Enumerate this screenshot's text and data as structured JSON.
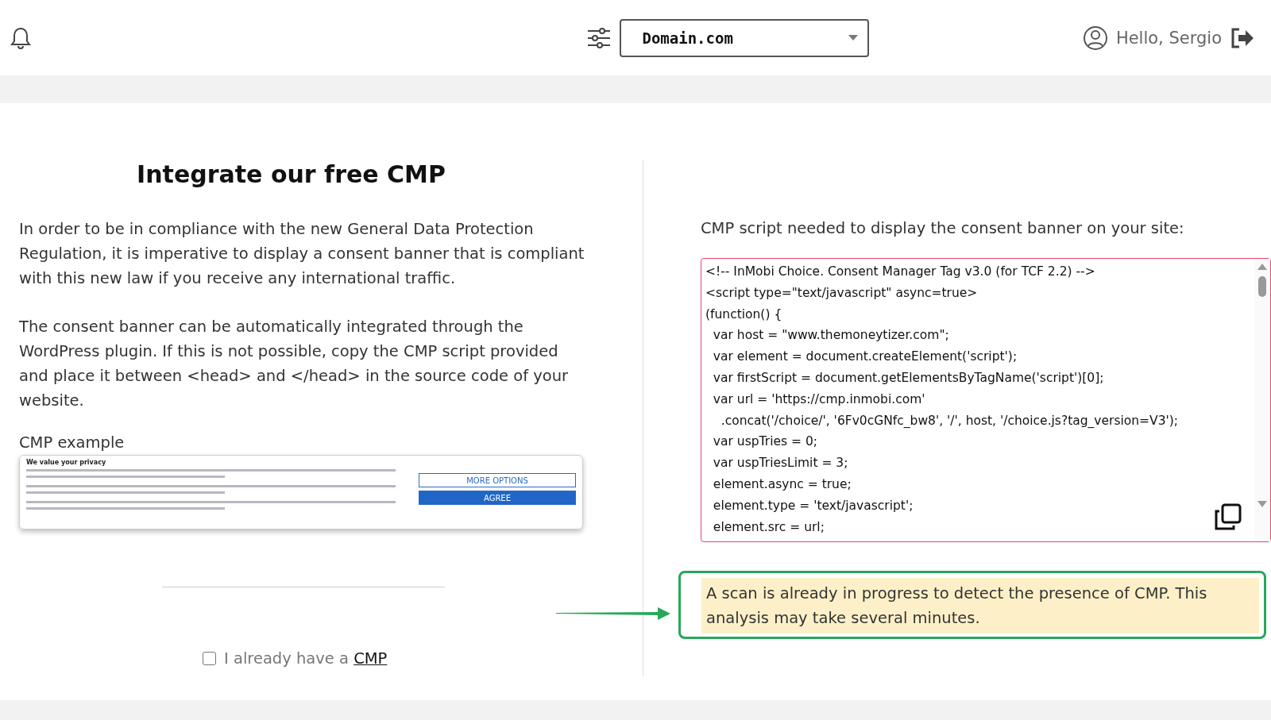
{
  "header": {
    "domain_select": {
      "value": "Domain.com"
    },
    "greeting": "Hello, Sergio"
  },
  "left": {
    "title": "Integrate our free CMP",
    "paragraphs": [
      "In order to be in compliance with the new General Data Protection Regulation, it is imperative to display a consent banner that is compliant with this new law if you receive any international traffic.",
      "The consent banner can be automatically integrated through the WordPress plugin. If this is not possible, copy the CMP script provided and place it between <head> and </head> in the source code of your website."
    ],
    "example_label": "CMP example",
    "example": {
      "title": "We value your privacy",
      "buttons": [
        {
          "label": "MORE OPTIONS",
          "kind": "outline"
        },
        {
          "label": "AGREE",
          "kind": "filled"
        }
      ]
    },
    "checkbox": {
      "label": "I already have a",
      "link": "CMP",
      "checked": false
    }
  },
  "right": {
    "intro": "CMP script needed to display the consent banner on your site:",
    "code_lines": [
      "<!-- InMobi Choice. Consent Manager Tag v3.0 (for TCF 2.2) -->",
      "<script type=\"text/javascript\" async=true>",
      "(function() {",
      "  var host = \"www.themoneytizer.com\";",
      "  var element = document.createElement('script');",
      "  var firstScript = document.getElementsByTagName('script')[0];",
      "  var url = 'https://cmp.inmobi.com'",
      "    .concat('/choice/', '6Fv0cGNfc_bw8', '/', host, '/choice.js?tag_version=V3');",
      "  var uspTries = 0;",
      "  var uspTriesLimit = 3;",
      "  element.async = true;",
      "  element.type = 'text/javascript';",
      "  element.src = url;"
    ],
    "notice": "A scan is already in progress to detect the presence of CMP. This analysis may take several minutes."
  }
}
